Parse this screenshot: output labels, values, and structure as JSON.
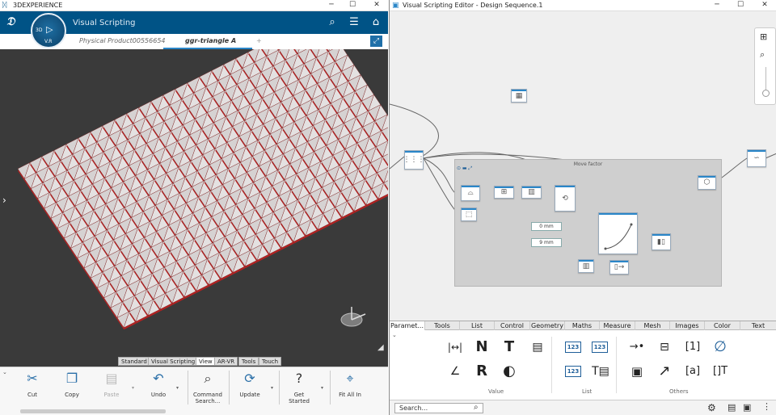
{
  "left_window": {
    "title": "3DEXPERIENCE",
    "app_name": "Visual Scripting",
    "compass_label": "V.R",
    "compass_top": "3D",
    "tabs": [
      "Physical Product00556654",
      "ggr-triangle A"
    ],
    "add_tab": "+",
    "ribbon_tabs": [
      "Standard",
      "Visual Scripting",
      "View",
      "AR-VR",
      "Tools",
      "Touch"
    ],
    "ribbon_buttons": [
      "Cut",
      "Copy",
      "Paste",
      "Undo",
      "Command Search...",
      "Update",
      "Get Started",
      "Fit All In"
    ]
  },
  "right_window": {
    "title": "Visual Scripting Editor - Design Sequence.1",
    "group_title": "Move factor",
    "value_inputs": [
      "0 mm",
      "9 mm"
    ],
    "palette_tabs": [
      "Paramet...",
      "Tools",
      "List",
      "Control",
      "Geometry",
      "Maths",
      "Measure",
      "Mesh",
      "Images",
      "Color",
      "Text"
    ],
    "palette_sections": [
      "Value",
      "List",
      "Others"
    ],
    "search_placeholder": "Search..."
  },
  "colors": {
    "header_blue": "#005386",
    "accent_blue": "#2a86c8",
    "triangle_red": "#b22222"
  }
}
